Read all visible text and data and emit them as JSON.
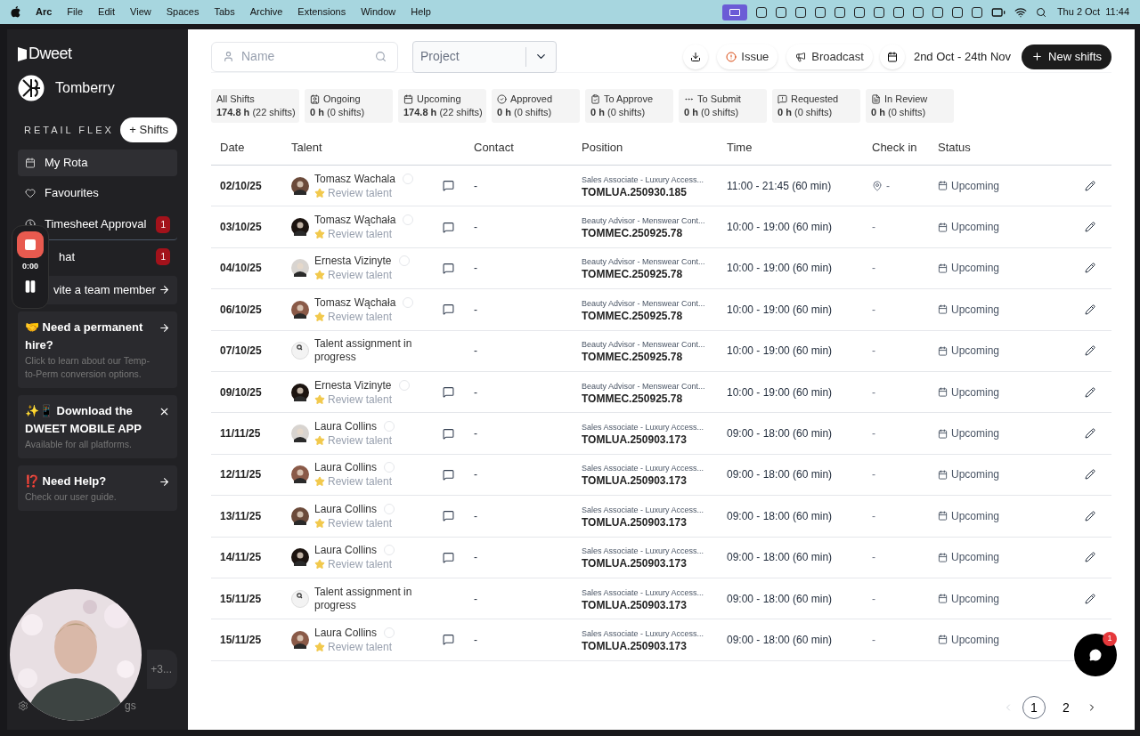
{
  "menu_bar": {
    "app": "Arc",
    "items": [
      "File",
      "Edit",
      "View",
      "Spaces",
      "Tabs",
      "Archive",
      "Extensions",
      "Window",
      "Help"
    ],
    "clock": "Thu 2 Oct  11:44"
  },
  "sidebar": {
    "brand": "Dweet",
    "company": "Tomberry",
    "section": "RETAIL FLEX",
    "add_button": "+ Shifts",
    "nav": [
      {
        "label": "My Rota",
        "selected": true
      },
      {
        "label": "Favourites",
        "selected": false
      },
      {
        "label": "Timesheet Approval",
        "selected": false,
        "badge": "1"
      },
      {
        "label": "hat",
        "selected": false,
        "badge": "1"
      }
    ],
    "invite": "vite a team member",
    "cards": [
      {
        "title": "🤝 Need a permanent hire?",
        "text": "Click to learn about our Temp-to-Perm conversion options."
      },
      {
        "title": "✨📱 Download the DWEET MOBILE APP",
        "text": "Available for all platforms."
      },
      {
        "title": "⁉️ Need Help?",
        "text": "Check our user guide."
      }
    ],
    "user_fragment": "+3...",
    "settings_fragment": "gs"
  },
  "recorder": {
    "time": "0:00"
  },
  "toolbar": {
    "name_placeholder": "Name",
    "project_placeholder": "Project",
    "issue": "Issue",
    "broadcast": "Broadcast",
    "date_range": "2nd Oct - 24th Nov",
    "new_button": "New shifts"
  },
  "filters": [
    {
      "label": "All Shifts",
      "hours": "174.8 h",
      "count": "(22 shifts)"
    },
    {
      "label": "Ongoing",
      "hours": "0 h",
      "count": "(0 shifts)"
    },
    {
      "label": "Upcoming",
      "hours": "174.8 h",
      "count": "(22 shifts)"
    },
    {
      "label": "Approved",
      "hours": "0 h",
      "count": "(0 shifts)"
    },
    {
      "label": "To Approve",
      "hours": "0 h",
      "count": "(0 shifts)"
    },
    {
      "label": "To Submit",
      "hours": "0 h",
      "count": "(0 shifts)"
    },
    {
      "label": "Requested",
      "hours": "0 h",
      "count": "(0 shifts)"
    },
    {
      "label": "In Review",
      "hours": "0 h",
      "count": "(0 shifts)"
    }
  ],
  "table": {
    "columns": [
      "Date",
      "Talent",
      "Contact",
      "Position",
      "Time",
      "Check in",
      "Status"
    ],
    "rows": [
      {
        "date": "02/10/25",
        "kind": "talent",
        "talent": "Tomasz Wachala",
        "sub": "Review talent",
        "contact": "-",
        "position": "Sales Associate - Luxury Access...",
        "code": "TOMLUA.250930.185",
        "time": "11:00 - 21:45 (60 min)",
        "checkin": "-",
        "pin": true,
        "status": "Upcoming"
      },
      {
        "date": "03/10/25",
        "kind": "talent",
        "talent": "Tomasz Wąchała",
        "sub": "Review talent",
        "contact": "-",
        "position": "Beauty Advisor - Menswear Cont...",
        "code": "TOMMEC.250925.78",
        "time": "10:00 - 19:00 (60 min)",
        "checkin": "-",
        "pin": false,
        "status": "Upcoming"
      },
      {
        "date": "04/10/25",
        "kind": "talent",
        "talent": "Ernesta Vizinyte",
        "sub": "Review talent",
        "contact": "-",
        "position": "Beauty Advisor - Menswear Cont...",
        "code": "TOMMEC.250925.78",
        "time": "10:00 - 19:00 (60 min)",
        "checkin": "-",
        "pin": false,
        "status": "Upcoming"
      },
      {
        "date": "06/10/25",
        "kind": "talent",
        "talent": "Tomasz Wąchała",
        "sub": "Review talent",
        "contact": "-",
        "position": "Beauty Advisor - Menswear Cont...",
        "code": "TOMMEC.250925.78",
        "time": "10:00 - 19:00 (60 min)",
        "checkin": "-",
        "pin": false,
        "status": "Upcoming"
      },
      {
        "date": "07/10/25",
        "kind": "pending",
        "talent": "Talent assignment in progress",
        "contact": "-",
        "position": "Beauty Advisor - Menswear Cont...",
        "code": "TOMMEC.250925.78",
        "time": "10:00 - 19:00 (60 min)",
        "checkin": "-",
        "pin": false,
        "status": "Upcoming"
      },
      {
        "date": "09/10/25",
        "kind": "talent",
        "talent": "Ernesta Vizinyte",
        "sub": "Review talent",
        "contact": "-",
        "position": "Beauty Advisor - Menswear Cont...",
        "code": "TOMMEC.250925.78",
        "time": "10:00 - 19:00 (60 min)",
        "checkin": "-",
        "pin": false,
        "status": "Upcoming"
      },
      {
        "date": "11/11/25",
        "kind": "talent",
        "talent": "Laura Collins",
        "sub": "Review talent",
        "contact": "-",
        "position": "Sales Associate - Luxury Access...",
        "code": "TOMLUA.250903.173",
        "time": "09:00 - 18:00 (60 min)",
        "checkin": "-",
        "pin": false,
        "status": "Upcoming"
      },
      {
        "date": "12/11/25",
        "kind": "talent",
        "talent": "Laura Collins",
        "sub": "Review talent",
        "contact": "-",
        "position": "Sales Associate - Luxury Access...",
        "code": "TOMLUA.250903.173",
        "time": "09:00 - 18:00 (60 min)",
        "checkin": "-",
        "pin": false,
        "status": "Upcoming"
      },
      {
        "date": "13/11/25",
        "kind": "talent",
        "talent": "Laura Collins",
        "sub": "Review talent",
        "contact": "-",
        "position": "Sales Associate - Luxury Access...",
        "code": "TOMLUA.250903.173",
        "time": "09:00 - 18:00 (60 min)",
        "checkin": "-",
        "pin": false,
        "status": "Upcoming"
      },
      {
        "date": "14/11/25",
        "kind": "talent",
        "talent": "Laura Collins",
        "sub": "Review talent",
        "contact": "-",
        "position": "Sales Associate - Luxury Access...",
        "code": "TOMLUA.250903.173",
        "time": "09:00 - 18:00 (60 min)",
        "checkin": "-",
        "pin": false,
        "status": "Upcoming"
      },
      {
        "date": "15/11/25",
        "kind": "pending",
        "talent": "Talent assignment in progress",
        "contact": "-",
        "position": "Sales Associate - Luxury Access...",
        "code": "TOMLUA.250903.173",
        "time": "09:00 - 18:00 (60 min)",
        "checkin": "-",
        "pin": false,
        "status": "Upcoming"
      },
      {
        "date": "15/11/25",
        "kind": "talent",
        "talent": "Laura Collins",
        "sub": "Review talent",
        "contact": "-",
        "position": "Sales Associate - Luxury Access...",
        "code": "TOMLUA.250903.173",
        "time": "09:00 - 18:00 (60 min)",
        "checkin": "-",
        "pin": false,
        "status": "Upcoming"
      }
    ]
  },
  "pagination": [
    {
      "label": "1",
      "selected": true
    },
    {
      "label": "2",
      "selected": false
    }
  ],
  "chat_badge": "1"
}
